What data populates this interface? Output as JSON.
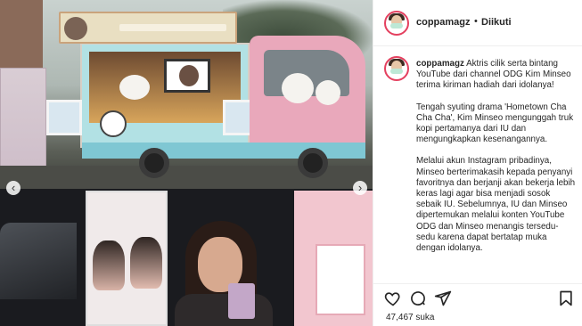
{
  "post": {
    "username": "coppamagz",
    "follow_dot": "•",
    "follow_status": "Diikuti",
    "likes_count": "47,467",
    "likes_suffix": "suka"
  },
  "photo": {
    "sign_text": "민서 팬 아이유가 민서를 응원합니다!",
    "carousel_prev": "‹",
    "carousel_next": "›"
  },
  "caption": {
    "username": "coppamagz",
    "paragraphs": [
      "Aktris cilik serta bintang YouTube dari channel ODG Kim Minseo terima kiriman hadiah dari idolanya!",
      "Tengah syuting drama 'Hometown Cha Cha Cha', Kim Minseo mengunggah truk kopi pertamanya dari IU dan mengungkapkan kesenangannya.",
      "Melalui akun Instagram pribadinya, Minseo berterimakasih kepada penyanyi favoritnya dan berjanji akan bekerja lebih keras lagi agar bisa menjadi sosok sebaik IU. Sebelumnya, IU dan Minseo dipertemukan melalui konten YouTube ODG dan Minseo menangis tersedu-sedu karena dapat bertatap muka dengan idolanya."
    ]
  },
  "icons": {
    "like": "heart-icon",
    "comment": "comment-icon",
    "share": "share-icon",
    "save": "bookmark-icon"
  },
  "colors": {
    "story_ring": "#e4405f",
    "text": "#262626",
    "divider": "#efefef"
  }
}
